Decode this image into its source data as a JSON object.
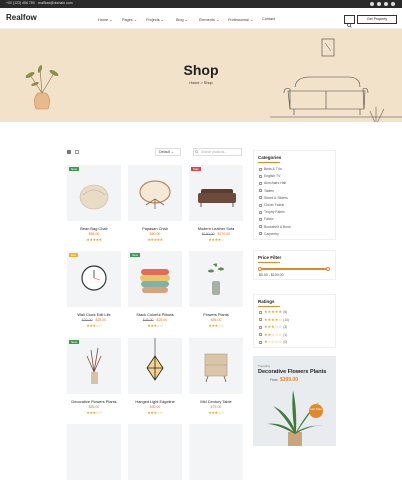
{
  "topbar": {
    "phone": "+00 (123) 456 789",
    "email": "realflow@domain.com"
  },
  "header": {
    "logo": "Realfow",
    "nav": [
      "Home ⌄",
      "Pages ⌄",
      "Projects ⌄",
      "Blog ⌄",
      "Elements ⌄",
      "Professional ⌄",
      "Contact"
    ],
    "cta": "Get Property"
  },
  "hero": {
    "title": "Shop",
    "breadcrumb": "Home > Shop"
  },
  "toolbar": {
    "sort": "Default ⌄",
    "search_placeholder": "Search products..."
  },
  "products": [
    {
      "name": "Bean Bag Chair",
      "old": "",
      "price": "$55.00",
      "badge": "New",
      "stars": "★★★★★"
    },
    {
      "name": "Papasan Chair",
      "old": "",
      "price": "$60.00",
      "badge": "",
      "stars": "★★★★★"
    },
    {
      "name": "Modern Leather Sofa",
      "old": "$190.00",
      "price": "$170.00",
      "badge": "Sale",
      "stars": "★★★★☆"
    },
    {
      "name": "Wall Clock Edit Life",
      "old": "$30.00",
      "price": "$25.00",
      "badge": "Hot",
      "stars": "★★★☆☆"
    },
    {
      "name": "Stack Colorful Pillows",
      "old": "$35.00",
      "price": "$25.00",
      "badge": "New",
      "stars": "★★★☆☆"
    },
    {
      "name": "Flowers Plants",
      "old": "",
      "price": "$45.00",
      "badge": "",
      "stars": "★★★☆☆"
    },
    {
      "name": "Decorative Flowers Plants",
      "old": "",
      "price": "$55.00",
      "badge": "New",
      "stars": "★★★☆☆"
    },
    {
      "name": "Hanged Light Edgeline",
      "old": "",
      "price": "$30.00",
      "badge": "",
      "stars": "★★★☆☆"
    },
    {
      "name": "Mid Century Table",
      "old": "",
      "price": "$75.00",
      "badge": "",
      "stars": "★★★☆☆"
    }
  ],
  "sidebar": {
    "categories_title": "Categories",
    "categories": [
      "Beds & TVs",
      "English TV",
      "Armchairs Hall",
      "Tables",
      "Sliced & Sliders",
      "Clover Fabric",
      "Trophy Fabric",
      "Fabric",
      "Bookshelf & Book",
      "Carpentry"
    ],
    "price_title": "Price Filter",
    "price_range": "$0.00 - $100.00",
    "ratings_title": "Ratings",
    "ratings": [
      {
        "stars": "★★★★★",
        "count": "(6)"
      },
      {
        "stars": "★★★★☆",
        "count": "(10)"
      },
      {
        "stars": "★★★☆☆",
        "count": "(3)"
      },
      {
        "stars": "★★☆☆☆",
        "count": "(1)"
      },
      {
        "stars": "★☆☆☆☆",
        "count": "(0)"
      }
    ],
    "promo": {
      "tag": "Trending",
      "title": "Decorative Flowers Plants",
      "price_from": "From",
      "price": "$399.00",
      "sticker": "Hot Sale"
    }
  },
  "colors": {
    "accent": "#e28a2b",
    "hero_bg": "#f2e2c9",
    "badge_new": "#3a9b4f",
    "badge_sale": "#d94848",
    "badge_hot": "#f0b429"
  }
}
